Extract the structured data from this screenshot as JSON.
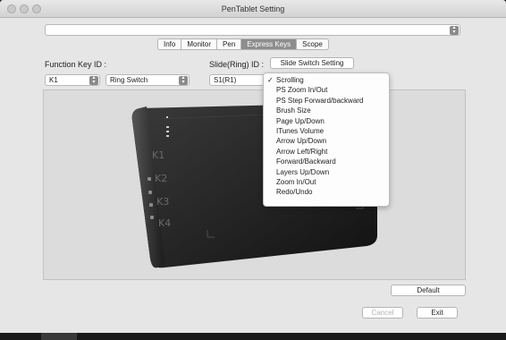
{
  "window": {
    "title": "PenTablet Setting"
  },
  "tabs": [
    {
      "label": "Info",
      "active": false
    },
    {
      "label": "Monitor",
      "active": false
    },
    {
      "label": "Pen",
      "active": false
    },
    {
      "label": "Express Keys",
      "active": true
    },
    {
      "label": "Scope",
      "active": false
    }
  ],
  "function_key": {
    "label": "Function Key ID :",
    "id_value": "K1",
    "action_value": "Ring Switch"
  },
  "slide": {
    "label": "Slide(Ring) ID :",
    "setting_button": "Slide Switch Setting",
    "id_value": "S1(R1)"
  },
  "dropdown": {
    "selected": "Scrolling",
    "items": [
      "Scrolling",
      "PS Zoom In/Out",
      "PS Step Forward/backward",
      "Brush Size",
      "Page Up/Down",
      "ITunes Volume",
      "Arrow Up/Down",
      "Arrow Left/Right",
      "Forward/Backward",
      "Layers Up/Down",
      "Zoom In/Out",
      "Redo/Undo"
    ]
  },
  "tablet_keys": [
    "K1",
    "K2",
    "K3",
    "K4"
  ],
  "buttons": {
    "default": "Default",
    "cancel": "Cancel",
    "exit": "Exit"
  },
  "colors": {
    "active_tab": "#8d8d8d",
    "tablet_body": "#2b2b2b"
  }
}
